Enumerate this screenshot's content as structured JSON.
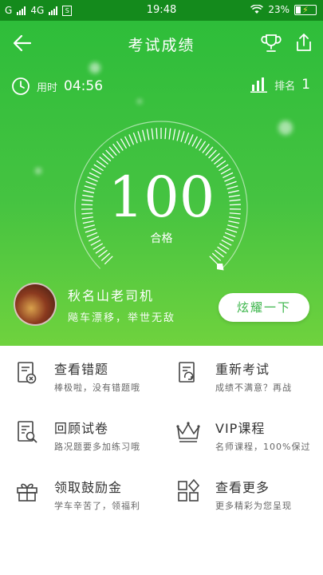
{
  "status": {
    "carrier1": "G",
    "carrier2": "4G",
    "time": "19:48",
    "battery": "23%"
  },
  "header": {
    "title": "考试成绩"
  },
  "stats": {
    "time_label": "用时",
    "time_value": "04:56",
    "rank_label": "排名",
    "rank_value": "1"
  },
  "result": {
    "score": "100",
    "pass_label": "合格",
    "progress": 1.0
  },
  "user": {
    "name": "秋名山老司机",
    "motto": "飚车漂移，举世无敌"
  },
  "show_button": "炫耀一下",
  "menu": [
    {
      "title": "查看错题",
      "sub": "棒极啦，没有错题哦",
      "icon": "wrong-questions-icon"
    },
    {
      "title": "重新考试",
      "sub": "成绩不满意？再战",
      "icon": "retake-exam-icon"
    },
    {
      "title": "回顾试卷",
      "sub": "路况题要多加练习哦",
      "icon": "review-paper-icon"
    },
    {
      "title": "VIP课程",
      "sub": "名师课程，100%保过",
      "icon": "crown-icon"
    },
    {
      "title": "领取鼓励金",
      "sub": "学车辛苦了，领福利",
      "icon": "gift-icon"
    },
    {
      "title": "查看更多",
      "sub": "更多精彩为您呈现",
      "icon": "more-apps-icon"
    }
  ],
  "colors": {
    "status_bar": "#148a1c",
    "hero_top": "#2ebd3a",
    "hero_bottom": "#6fd23e",
    "accent": "#3bb54a"
  }
}
